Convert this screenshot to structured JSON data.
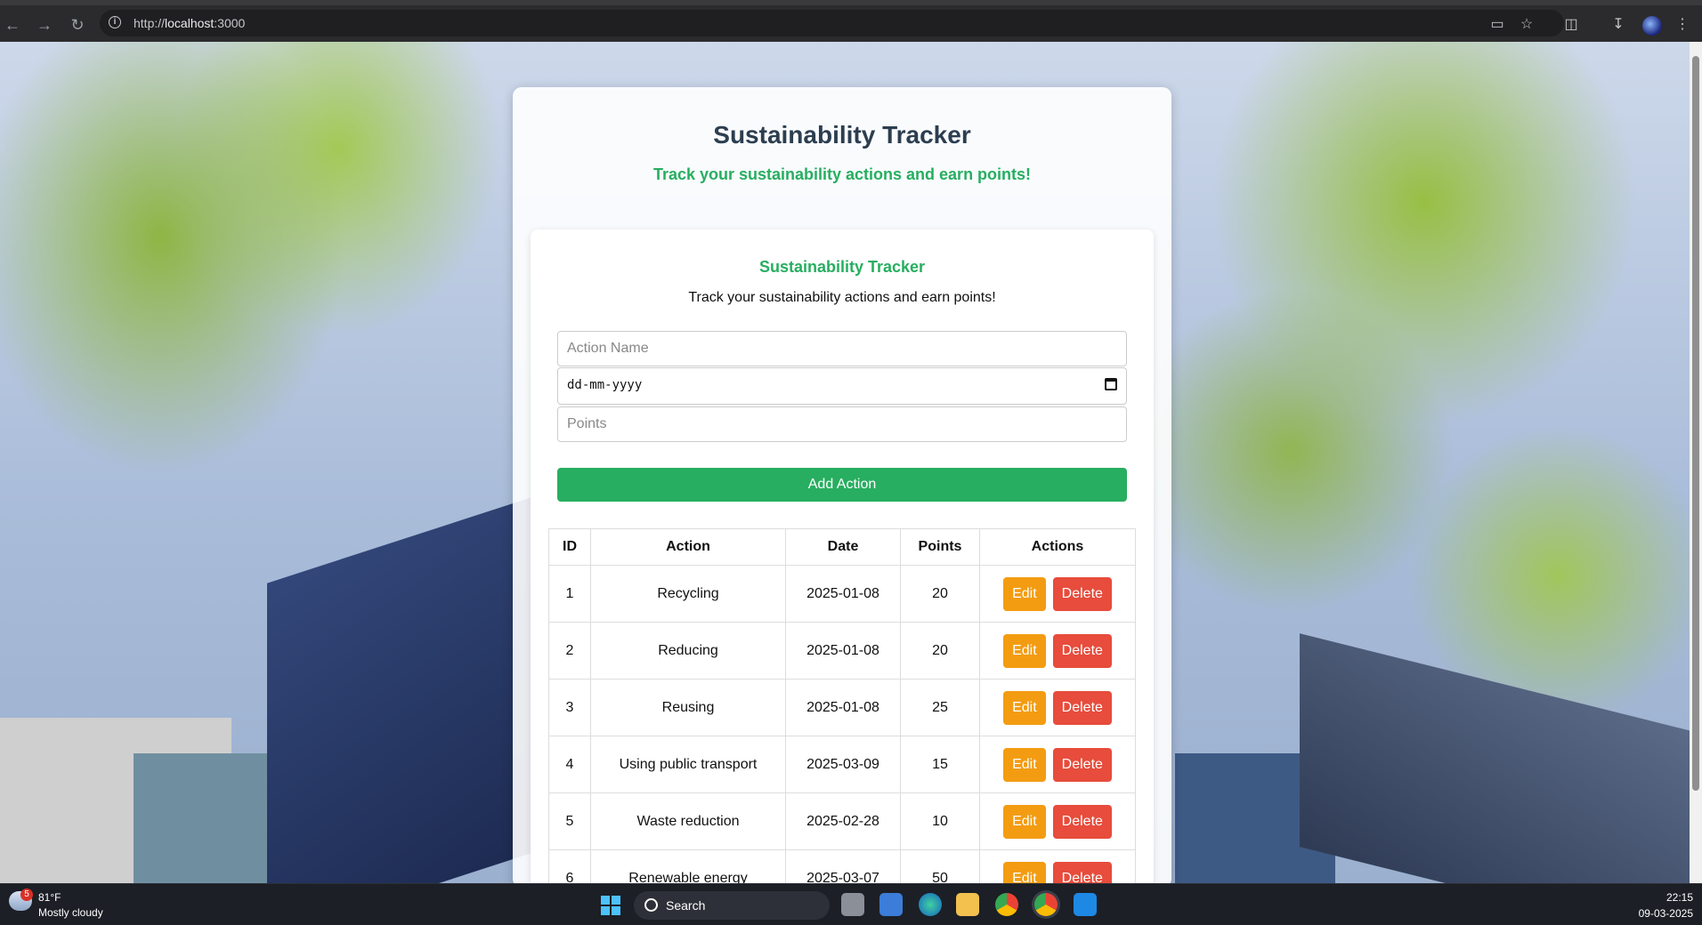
{
  "browser": {
    "url_prefix": "http://",
    "url_host": "localhost",
    "url_port": ":3000",
    "icons": [
      "back-icon",
      "forward-icon",
      "reload-icon",
      "info-icon",
      "install-icon",
      "star-icon",
      "extensions-icon",
      "downloads-icon",
      "profile-avatar",
      "menu-icon"
    ]
  },
  "page": {
    "title": "Sustainability Tracker",
    "subtitle": "Track your sustainability actions and earn points!"
  },
  "card": {
    "title": "Sustainability Tracker",
    "description": "Track your sustainability actions and earn points!",
    "action_name_placeholder": "Action Name",
    "date_placeholder": "dd-mm-yyyy",
    "points_placeholder": "Points",
    "add_button": "Add Action"
  },
  "table": {
    "headers": [
      "ID",
      "Action",
      "Date",
      "Points",
      "Actions"
    ],
    "edit_label": "Edit",
    "delete_label": "Delete",
    "rows": [
      {
        "id": "1",
        "action": "Recycling",
        "date": "2025-01-08",
        "points": "20"
      },
      {
        "id": "2",
        "action": "Reducing",
        "date": "2025-01-08",
        "points": "20"
      },
      {
        "id": "3",
        "action": "Reusing",
        "date": "2025-01-08",
        "points": "25"
      },
      {
        "id": "4",
        "action": "Using public transport",
        "date": "2025-03-09",
        "points": "15"
      },
      {
        "id": "5",
        "action": "Waste reduction",
        "date": "2025-02-28",
        "points": "10"
      },
      {
        "id": "6",
        "action": "Renewable energy",
        "date": "2025-03-07",
        "points": "50"
      }
    ]
  },
  "taskbar": {
    "weather_temp": "81°F",
    "weather_desc": "Mostly cloudy",
    "weather_badge": "5",
    "search_label": "Search",
    "time": "22:15",
    "date": "09-03-2025"
  },
  "colors": {
    "accent_green": "#27ae60",
    "title_dark": "#2c3e50",
    "edit_orange": "#f39c12",
    "delete_red": "#e74c3c"
  }
}
